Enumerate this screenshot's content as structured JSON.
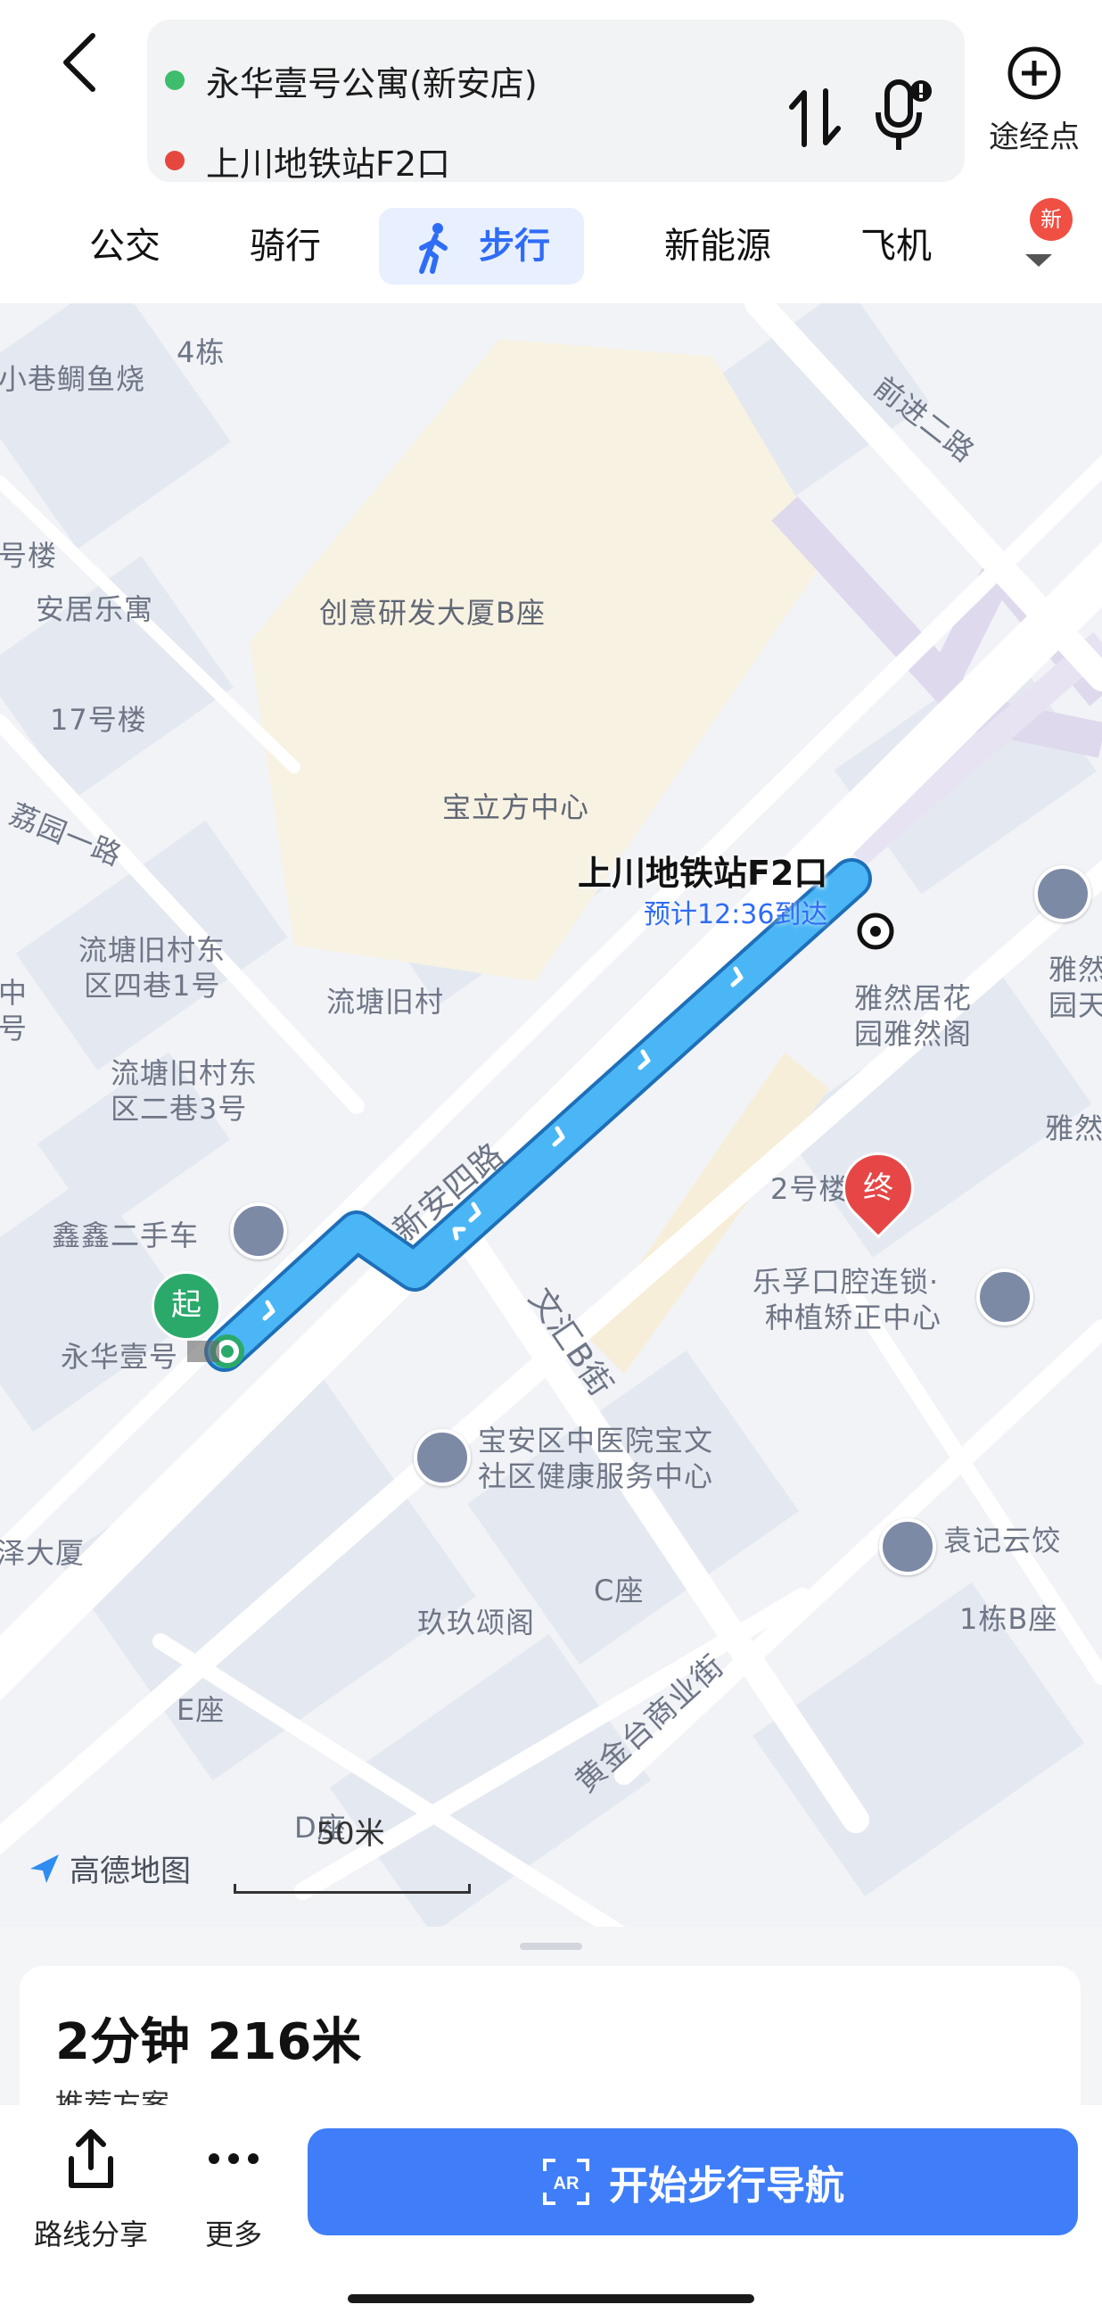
{
  "route": {
    "start": "永华壹号公寓(新安店)",
    "end": "上川地铁站F2口",
    "start_color": "#3ebd6c",
    "end_color": "#e5473f"
  },
  "header": {
    "waypoint_label": "途经点"
  },
  "tabs": {
    "bus": "公交",
    "bike": "骑行",
    "walk": "步行",
    "ev": "新能源",
    "plane": "飞机",
    "new_badge": "新",
    "active_color": "#2f6cf6"
  },
  "map": {
    "labels": {
      "l1": "4栋",
      "l2": "小巷鲷鱼烧",
      "l3": "号楼",
      "l4": "安居乐寓",
      "l5": "17号楼",
      "l6": "荔园一路",
      "l7": "创意研发大厦B座",
      "l8": "宝立方中心",
      "l9": "前进二路",
      "l10": "流塘旧村东",
      "l11": "区四巷1号",
      "l12": "流塘旧村",
      "l13": "流塘旧村东",
      "l14": "区二巷3号",
      "l15": "鑫鑫二手车",
      "l16": "永华壹号",
      "l17": "新安四路",
      "l18": "文汇B街",
      "l19": "2号楼",
      "l20": "乐孚口腔连锁·",
      "l21": "种植矫正中心",
      "l22": "宝安区中医院宝文",
      "l23": "社区健康服务中心",
      "l24": "袁记云饺",
      "l25": "C座",
      "l26": "玖玖颂阁",
      "l27": "1栋B座",
      "l28": "E座",
      "l29": "黄金台商业街",
      "l30": "D座",
      "l31": "泽大厦",
      "l32": "雅然居花",
      "l33": "园雅然阁",
      "l34": "雅然",
      "l35": "园天",
      "l36": "雅然",
      "l37": "中",
      "l38": "号"
    },
    "dest_name": "上川地铁站F2口",
    "dest_eta": "预计12:36到达",
    "start_pin": "起",
    "end_pin": "终",
    "logo_text": "高德地图",
    "scale_text": "50米",
    "route_color": "#4ab6f5"
  },
  "sheet": {
    "summary": "2分钟  216米",
    "subtitle": "推荐方案"
  },
  "actions": {
    "share": "路线分享",
    "more": "更多",
    "navigate": "开始步行导航",
    "nav_color": "#3f7ef8"
  }
}
